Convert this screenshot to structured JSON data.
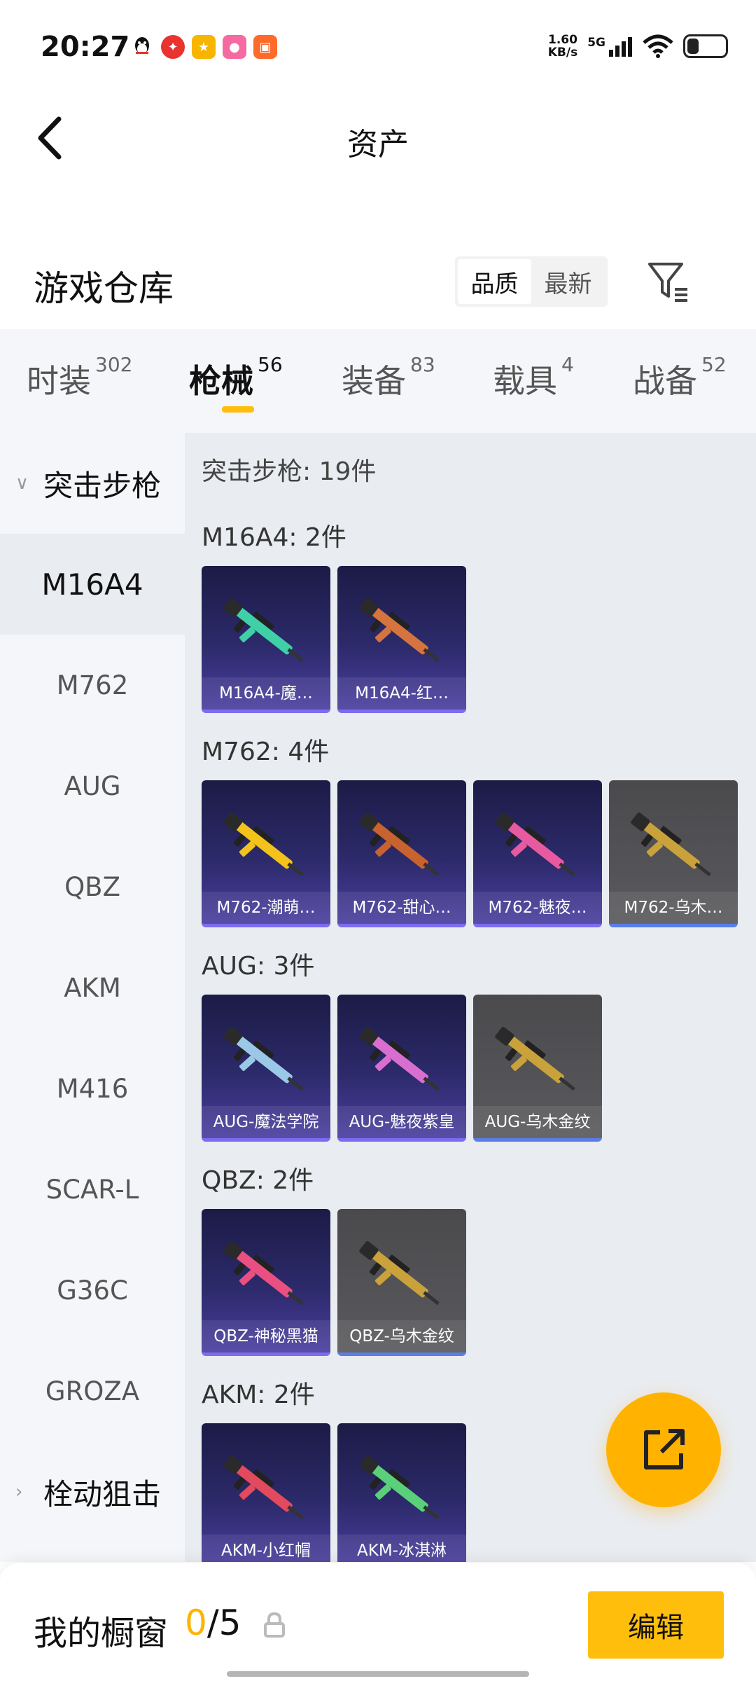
{
  "status_bar": {
    "time": "20:27",
    "net_speed_value": "1.60",
    "net_speed_unit": "KB/s",
    "network": "5G",
    "app_icons": [
      {
        "icon": "qq-icon",
        "color": "#ffffff"
      },
      {
        "icon": "app-red-icon",
        "color": "#e8332e"
      },
      {
        "icon": "app-yellow-icon",
        "color": "#f8b500"
      },
      {
        "icon": "app-pink-icon",
        "color": "#f56aa0"
      },
      {
        "icon": "app-orange-icon",
        "color": "#ff6a2b"
      }
    ]
  },
  "header": {
    "title": "资产"
  },
  "warehouse": {
    "title": "游戏仓库",
    "sort_options": [
      "品质",
      "最新"
    ],
    "sort_selected": "品质"
  },
  "tabs": [
    {
      "label": "时装",
      "count": "302"
    },
    {
      "label": "枪械",
      "count": "56",
      "active": true
    },
    {
      "label": "装备",
      "count": "83"
    },
    {
      "label": "载具",
      "count": "4"
    },
    {
      "label": "战备",
      "count": "52"
    }
  ],
  "sidebar": {
    "group_open": "突击步枪",
    "items": [
      "M16A4",
      "M762",
      "AUG",
      "QBZ",
      "AKM",
      "M416",
      "SCAR-L",
      "G36C",
      "GROZA"
    ],
    "selected": "M16A4",
    "group_closed": "栓动狙击"
  },
  "content": {
    "summary": "突击步枪: 19件",
    "sections": [
      {
        "title": "M16A4: 2件",
        "items": [
          {
            "name": "M16A4-魔…",
            "tier": "purple",
            "color": "#3fd0a8"
          },
          {
            "name": "M16A4-红…",
            "tier": "purple",
            "color": "#d5743e"
          }
        ]
      },
      {
        "title": "M762: 4件",
        "items": [
          {
            "name": "M762-潮萌…",
            "tier": "purple",
            "color": "#f3c21b"
          },
          {
            "name": "M762-甜心…",
            "tier": "purple",
            "color": "#c8622f"
          },
          {
            "name": "M762-魅夜…",
            "tier": "purple",
            "color": "#e75aa0"
          },
          {
            "name": "M762-乌木…",
            "tier": "gray",
            "color": "#c9a23b"
          }
        ]
      },
      {
        "title": "AUG: 3件",
        "items": [
          {
            "name": "AUG-魔法学院",
            "tier": "purple",
            "color": "#9cc8e8"
          },
          {
            "name": "AUG-魅夜紫皇",
            "tier": "purple",
            "color": "#d86fd0"
          },
          {
            "name": "AUG-乌木金纹",
            "tier": "gray",
            "color": "#c9a23b"
          }
        ]
      },
      {
        "title": "QBZ: 2件",
        "items": [
          {
            "name": "QBZ-神秘黑猫",
            "tier": "purple",
            "color": "#ea4f82"
          },
          {
            "name": "QBZ-乌木金纹",
            "tier": "gray",
            "color": "#c9a23b"
          }
        ]
      },
      {
        "title": "AKM: 2件",
        "items": [
          {
            "name": "AKM-小红帽",
            "tier": "purple",
            "color": "#e24a5e"
          },
          {
            "name": "AKM-冰淇淋",
            "tier": "purple",
            "color": "#5ad07a"
          }
        ]
      }
    ]
  },
  "showcase": {
    "label": "我的橱窗",
    "current": "0",
    "separator": "/",
    "max": "5",
    "edit_label": "编辑"
  },
  "colors": {
    "accent": "#ffbe0b",
    "panel_bg": "#f4f6f9",
    "content_bg": "#e9ecf0"
  }
}
